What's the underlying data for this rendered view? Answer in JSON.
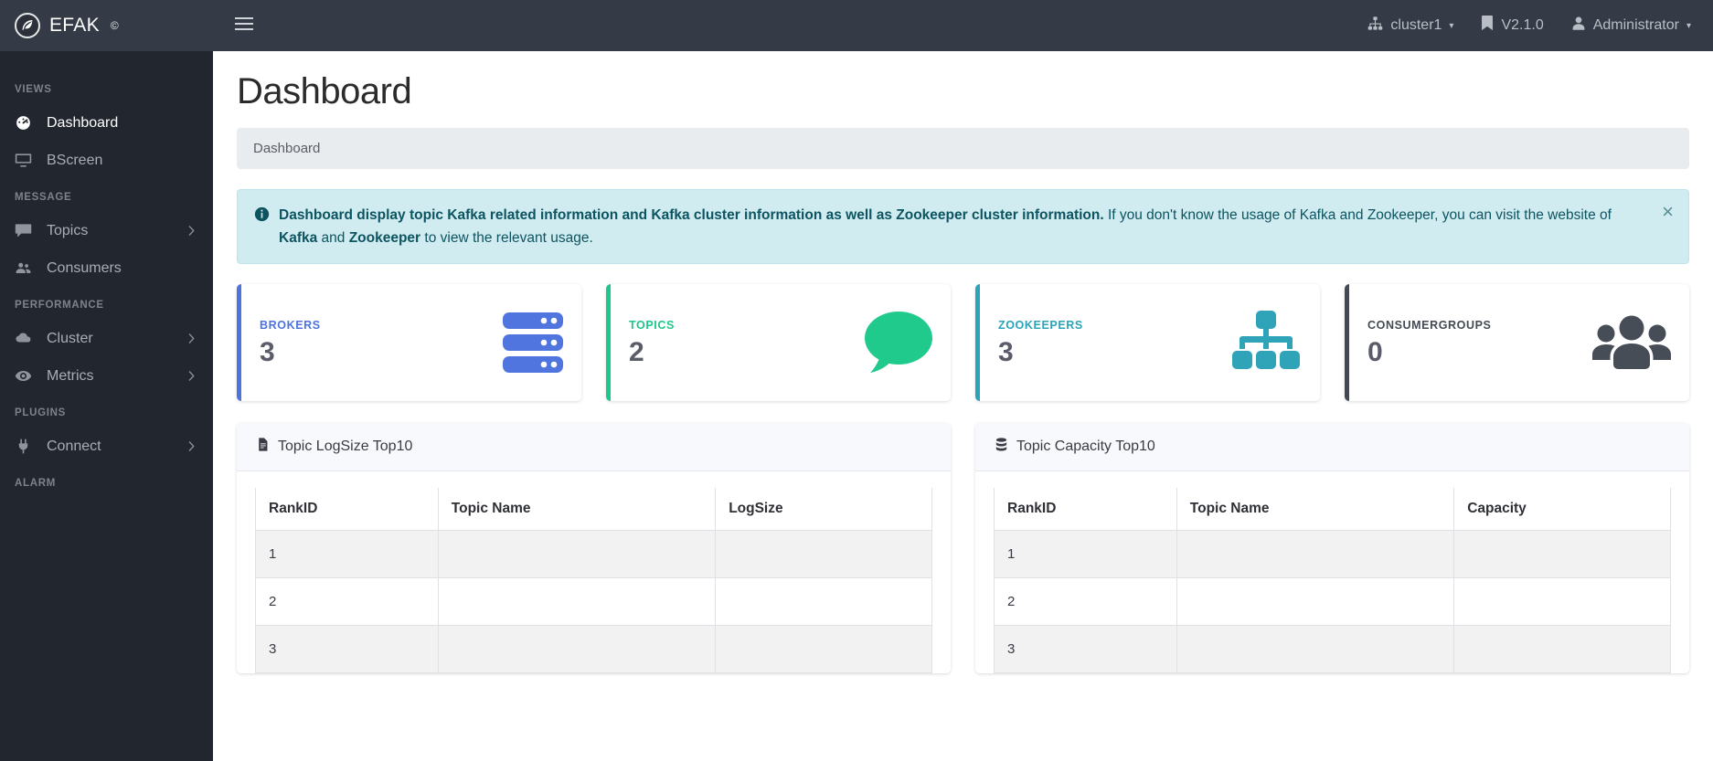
{
  "brand": {
    "name": "EFAK",
    "superscript": "©",
    "logo_icon": "feather-circle-icon"
  },
  "topbar": {
    "menu_toggle_icon": "hamburger-icon",
    "cluster": {
      "label": "cluster1",
      "icon": "sitemap-icon",
      "caret": "▾"
    },
    "version": {
      "label": "V2.1.0",
      "icon": "bookmark-icon"
    },
    "user": {
      "label": "Administrator",
      "icon": "user-icon",
      "caret": "▾"
    }
  },
  "sidebar": {
    "sections": [
      {
        "title": "VIEWS",
        "items": [
          {
            "label": "Dashboard",
            "icon": "tachometer-icon",
            "active": true,
            "has_caret": false
          },
          {
            "label": "BScreen",
            "icon": "desktop-icon",
            "active": false,
            "has_caret": false
          }
        ]
      },
      {
        "title": "MESSAGE",
        "items": [
          {
            "label": "Topics",
            "icon": "comment-icon",
            "active": false,
            "has_caret": true
          },
          {
            "label": "Consumers",
            "icon": "users-icon",
            "active": false,
            "has_caret": false
          }
        ]
      },
      {
        "title": "PERFORMANCE",
        "items": [
          {
            "label": "Cluster",
            "icon": "cloud-icon",
            "active": false,
            "has_caret": true
          },
          {
            "label": "Metrics",
            "icon": "eye-icon",
            "active": false,
            "has_caret": true
          }
        ]
      },
      {
        "title": "PLUGINS",
        "items": [
          {
            "label": "Connect",
            "icon": "plug-icon",
            "active": false,
            "has_caret": true
          }
        ]
      },
      {
        "title": "ALARM",
        "items": []
      }
    ]
  },
  "page": {
    "title": "Dashboard",
    "breadcrumb": "Dashboard"
  },
  "alert": {
    "icon": "info-circle-icon",
    "strong_1": "Dashboard display topic Kafka related information and Kafka cluster information as well as Zookeeper cluster information.",
    "text_1": " If you don't know the usage of Kafka and Zookeeper, you can visit the website of ",
    "link_1": "Kafka",
    "text_2": " and ",
    "link_2": "Zookeeper",
    "text_3": " to view the relevant usage.",
    "close_icon": "close-icon",
    "close_label": "×"
  },
  "cards": [
    {
      "label": "BROKERS",
      "value": "3",
      "accent": "#4e73df",
      "icon": "server-icon"
    },
    {
      "label": "TOPICS",
      "value": "2",
      "accent": "#1cc88a",
      "icon": "comment-icon"
    },
    {
      "label": "ZOOKEEPERS",
      "value": "3",
      "accent": "#2ba3b8",
      "icon": "sitemap-icon"
    },
    {
      "label": "CONSUMERGROUPS",
      "value": "0",
      "accent": "#434a54",
      "icon": "users-group-icon"
    }
  ],
  "panels": [
    {
      "title": "Topic LogSize Top10",
      "icon": "file-alt-icon",
      "columns": [
        "RankID",
        "Topic Name",
        "LogSize"
      ],
      "rows": [
        {
          "rank": "1",
          "name": "",
          "value": ""
        },
        {
          "rank": "2",
          "name": "",
          "value": ""
        },
        {
          "rank": "3",
          "name": "",
          "value": ""
        }
      ]
    },
    {
      "title": "Topic Capacity Top10",
      "icon": "database-icon",
      "columns": [
        "RankID",
        "Topic Name",
        "Capacity"
      ],
      "rows": [
        {
          "rank": "1",
          "name": "",
          "value": ""
        },
        {
          "rank": "2",
          "name": "",
          "value": ""
        },
        {
          "rank": "3",
          "name": "",
          "value": ""
        }
      ]
    }
  ]
}
